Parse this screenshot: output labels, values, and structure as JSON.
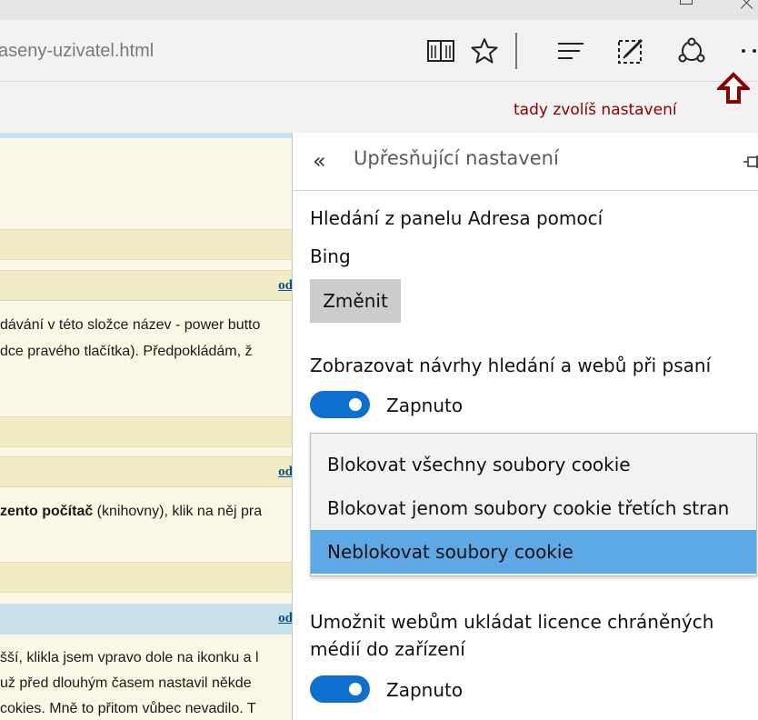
{
  "browser": {
    "url": "aseny-uzivatel.html",
    "toolbar_icons": [
      "reading-view-icon",
      "favorite-star-icon",
      "hub-icon",
      "web-note-icon",
      "share-icon",
      "more-icon"
    ],
    "more_label": "··"
  },
  "annotation": {
    "text": "tady zvolíš nastavení",
    "color": "#8b0000"
  },
  "background_page": {
    "link_label": "od",
    "para1": [
      "dávání v této složce název - power butto",
      "dce pravého tlačítka). Předpokládám, ž"
    ],
    "para2_bold": "zento počítač",
    "para2_rest": " (knihovny), klik na něj pra",
    "para3": [
      "šší, klikla jsem vpravo dole na ikonku a l",
      " už před dlouhým časem nastavil někde",
      "cokies. Mně to přitom vůbec nevadilo. T"
    ],
    "colors": {
      "page": "#faf7e6",
      "band_blue": "#c7e2ed",
      "band_beige": "#f1ebc6"
    }
  },
  "panel": {
    "back_icon": "«",
    "title": "Upřesňující nastavení",
    "search_label": "Hledání z panelu Adresa pomocí",
    "search_engine": "Bing",
    "change_button": "Změnit",
    "suggestions_label": "Zobrazovat návrhy hledání a webů při psaní",
    "suggestions_toggle": {
      "state": "Zapnuto",
      "on": true
    },
    "cookie_options": [
      {
        "label": "Blokovat všechny soubory cookie",
        "selected": false
      },
      {
        "label": "Blokovat jenom soubory cookie třetích stran",
        "selected": false
      },
      {
        "label": "Neblokovat soubory cookie",
        "selected": true
      }
    ],
    "licence_label_line1": "Umožnit webům ukládat licence chráněných",
    "licence_label_line2": "médií do zařízení",
    "licence_toggle": {
      "state": "Zapnuto",
      "on": true
    },
    "accent_color": "#0e6fcf",
    "selected_color": "#5ea8e6"
  }
}
